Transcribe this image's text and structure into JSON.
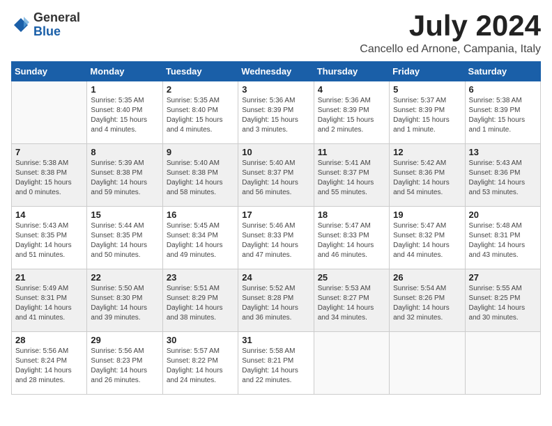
{
  "logo": {
    "general": "General",
    "blue": "Blue"
  },
  "header": {
    "month": "July 2024",
    "location": "Cancello ed Arnone, Campania, Italy"
  },
  "weekdays": [
    "Sunday",
    "Monday",
    "Tuesday",
    "Wednesday",
    "Thursday",
    "Friday",
    "Saturday"
  ],
  "weeks": [
    [
      {
        "day": "",
        "info": ""
      },
      {
        "day": "1",
        "info": "Sunrise: 5:35 AM\nSunset: 8:40 PM\nDaylight: 15 hours\nand 4 minutes."
      },
      {
        "day": "2",
        "info": "Sunrise: 5:35 AM\nSunset: 8:40 PM\nDaylight: 15 hours\nand 4 minutes."
      },
      {
        "day": "3",
        "info": "Sunrise: 5:36 AM\nSunset: 8:39 PM\nDaylight: 15 hours\nand 3 minutes."
      },
      {
        "day": "4",
        "info": "Sunrise: 5:36 AM\nSunset: 8:39 PM\nDaylight: 15 hours\nand 2 minutes."
      },
      {
        "day": "5",
        "info": "Sunrise: 5:37 AM\nSunset: 8:39 PM\nDaylight: 15 hours\nand 1 minute."
      },
      {
        "day": "6",
        "info": "Sunrise: 5:38 AM\nSunset: 8:39 PM\nDaylight: 15 hours\nand 1 minute."
      }
    ],
    [
      {
        "day": "7",
        "info": "Sunrise: 5:38 AM\nSunset: 8:38 PM\nDaylight: 15 hours\nand 0 minutes."
      },
      {
        "day": "8",
        "info": "Sunrise: 5:39 AM\nSunset: 8:38 PM\nDaylight: 14 hours\nand 59 minutes."
      },
      {
        "day": "9",
        "info": "Sunrise: 5:40 AM\nSunset: 8:38 PM\nDaylight: 14 hours\nand 58 minutes."
      },
      {
        "day": "10",
        "info": "Sunrise: 5:40 AM\nSunset: 8:37 PM\nDaylight: 14 hours\nand 56 minutes."
      },
      {
        "day": "11",
        "info": "Sunrise: 5:41 AM\nSunset: 8:37 PM\nDaylight: 14 hours\nand 55 minutes."
      },
      {
        "day": "12",
        "info": "Sunrise: 5:42 AM\nSunset: 8:36 PM\nDaylight: 14 hours\nand 54 minutes."
      },
      {
        "day": "13",
        "info": "Sunrise: 5:43 AM\nSunset: 8:36 PM\nDaylight: 14 hours\nand 53 minutes."
      }
    ],
    [
      {
        "day": "14",
        "info": "Sunrise: 5:43 AM\nSunset: 8:35 PM\nDaylight: 14 hours\nand 51 minutes."
      },
      {
        "day": "15",
        "info": "Sunrise: 5:44 AM\nSunset: 8:35 PM\nDaylight: 14 hours\nand 50 minutes."
      },
      {
        "day": "16",
        "info": "Sunrise: 5:45 AM\nSunset: 8:34 PM\nDaylight: 14 hours\nand 49 minutes."
      },
      {
        "day": "17",
        "info": "Sunrise: 5:46 AM\nSunset: 8:33 PM\nDaylight: 14 hours\nand 47 minutes."
      },
      {
        "day": "18",
        "info": "Sunrise: 5:47 AM\nSunset: 8:33 PM\nDaylight: 14 hours\nand 46 minutes."
      },
      {
        "day": "19",
        "info": "Sunrise: 5:47 AM\nSunset: 8:32 PM\nDaylight: 14 hours\nand 44 minutes."
      },
      {
        "day": "20",
        "info": "Sunrise: 5:48 AM\nSunset: 8:31 PM\nDaylight: 14 hours\nand 43 minutes."
      }
    ],
    [
      {
        "day": "21",
        "info": "Sunrise: 5:49 AM\nSunset: 8:31 PM\nDaylight: 14 hours\nand 41 minutes."
      },
      {
        "day": "22",
        "info": "Sunrise: 5:50 AM\nSunset: 8:30 PM\nDaylight: 14 hours\nand 39 minutes."
      },
      {
        "day": "23",
        "info": "Sunrise: 5:51 AM\nSunset: 8:29 PM\nDaylight: 14 hours\nand 38 minutes."
      },
      {
        "day": "24",
        "info": "Sunrise: 5:52 AM\nSunset: 8:28 PM\nDaylight: 14 hours\nand 36 minutes."
      },
      {
        "day": "25",
        "info": "Sunrise: 5:53 AM\nSunset: 8:27 PM\nDaylight: 14 hours\nand 34 minutes."
      },
      {
        "day": "26",
        "info": "Sunrise: 5:54 AM\nSunset: 8:26 PM\nDaylight: 14 hours\nand 32 minutes."
      },
      {
        "day": "27",
        "info": "Sunrise: 5:55 AM\nSunset: 8:25 PM\nDaylight: 14 hours\nand 30 minutes."
      }
    ],
    [
      {
        "day": "28",
        "info": "Sunrise: 5:56 AM\nSunset: 8:24 PM\nDaylight: 14 hours\nand 28 minutes."
      },
      {
        "day": "29",
        "info": "Sunrise: 5:56 AM\nSunset: 8:23 PM\nDaylight: 14 hours\nand 26 minutes."
      },
      {
        "day": "30",
        "info": "Sunrise: 5:57 AM\nSunset: 8:22 PM\nDaylight: 14 hours\nand 24 minutes."
      },
      {
        "day": "31",
        "info": "Sunrise: 5:58 AM\nSunset: 8:21 PM\nDaylight: 14 hours\nand 22 minutes."
      },
      {
        "day": "",
        "info": ""
      },
      {
        "day": "",
        "info": ""
      },
      {
        "day": "",
        "info": ""
      }
    ]
  ]
}
